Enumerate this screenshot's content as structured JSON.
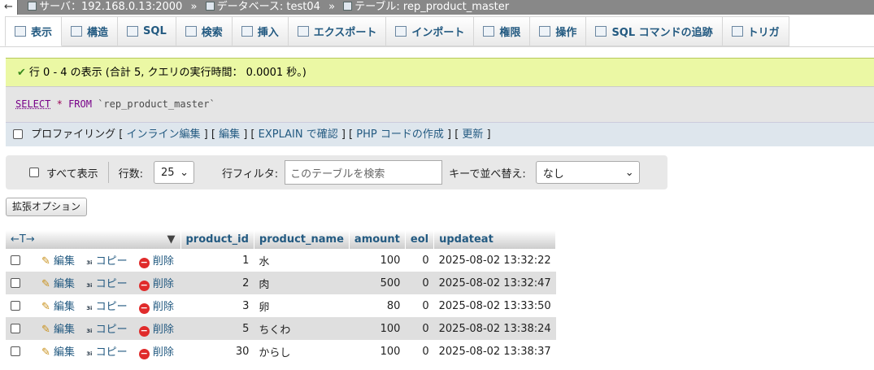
{
  "breadcrumb": {
    "back": "←",
    "server": "サーバ：192.168.0.13:2000",
    "database": "データベース: test04",
    "table": "テーブル: rep_product_master",
    "separator": "»"
  },
  "tabs": [
    {
      "label": "表示",
      "icon": "table-icon"
    },
    {
      "label": "構造",
      "icon": "structure-icon"
    },
    {
      "label": "SQL",
      "icon": "sql-icon"
    },
    {
      "label": "検索",
      "icon": "search-icon"
    },
    {
      "label": "挿入",
      "icon": "insert-icon"
    },
    {
      "label": "エクスポート",
      "icon": "export-icon"
    },
    {
      "label": "インポート",
      "icon": "import-icon"
    },
    {
      "label": "権限",
      "icon": "privileges-icon"
    },
    {
      "label": "操作",
      "icon": "wrench-icon"
    },
    {
      "label": "SQL コマンドの追跡",
      "icon": "eye-icon"
    },
    {
      "label": "トリガ",
      "icon": "trigger-icon"
    }
  ],
  "success": {
    "message": "行 0 - 4 の表示 (合計 5, クエリの実行時間： 0.0001 秒。)"
  },
  "sql": {
    "select": "SELECT",
    "star": "*",
    "from": "FROM",
    "table": "`rep_product_master`"
  },
  "profiling": {
    "label": "プロファイリング",
    "links": [
      "インライン編集",
      "編集",
      "EXPLAIN で確認",
      "PHP コードの作成",
      "更新"
    ]
  },
  "nav": {
    "show_all": "すべて表示",
    "rows_label": "行数:",
    "rows_value": "25",
    "filter_label": "行フィルタ:",
    "filter_placeholder": "このテーブルを検索",
    "sort_label": "キーで並べ替え:",
    "sort_value": "なし"
  },
  "options_button": "拡張オプション",
  "table": {
    "arrows": "←T→",
    "headers": [
      "product_id",
      "product_name",
      "amount",
      "eol",
      "updateat"
    ],
    "actions": {
      "edit": "編集",
      "copy": "コピー",
      "delete": "削除"
    },
    "rows": [
      {
        "product_id": "1",
        "product_name": "水",
        "amount": "100",
        "eol": "0",
        "updateat": "2025-08-02 13:32:22"
      },
      {
        "product_id": "2",
        "product_name": "肉",
        "amount": "500",
        "eol": "0",
        "updateat": "2025-08-02 13:32:47"
      },
      {
        "product_id": "3",
        "product_name": "卵",
        "amount": "80",
        "eol": "0",
        "updateat": "2025-08-02 13:33:50"
      },
      {
        "product_id": "5",
        "product_name": "ちくわ",
        "amount": "100",
        "eol": "0",
        "updateat": "2025-08-02 13:38:24"
      },
      {
        "product_id": "30",
        "product_name": "からし",
        "amount": "100",
        "eol": "0",
        "updateat": "2025-08-02 13:38:37"
      }
    ]
  }
}
